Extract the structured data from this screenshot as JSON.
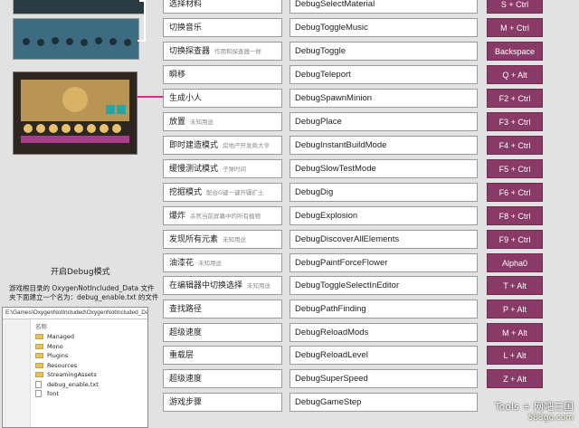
{
  "rows": [
    {
      "name": "选择材料",
      "note": "",
      "command": "DebugSelectMaterial",
      "key": "S + Ctrl"
    },
    {
      "name": "切换音乐",
      "note": "",
      "command": "DebugToggleMusic",
      "key": "M + Ctrl"
    },
    {
      "name": "切换探查器",
      "note": "作用和探查器一样",
      "command": "DebugToggle",
      "key": "Backspace"
    },
    {
      "name": "瞬移",
      "note": "",
      "command": "DebugTeleport",
      "key": "Q + Alt"
    },
    {
      "name": "生成小人",
      "note": "",
      "command": "DebugSpawnMinion",
      "key": "F2 + Ctrl"
    },
    {
      "name": "放置",
      "note": "未知用途",
      "command": "DebugPlace",
      "key": "F3 + Ctrl"
    },
    {
      "name": "即时建造模式",
      "note": "房地产开发商大亨",
      "command": "DebugInstantBuildMode",
      "key": "F4 + Ctrl"
    },
    {
      "name": "缓慢测试模式",
      "note": "子弹时间",
      "command": "DebugSlowTestMode",
      "key": "F5 + Ctrl"
    },
    {
      "name": "挖掘模式",
      "note": "配合G键一键开疆扩土",
      "command": "DebugDig",
      "key": "F6 + Ctrl"
    },
    {
      "name": "爆炸",
      "note": "杀死当前屏幕中的所有植物",
      "command": "DebugExplosion",
      "key": "F8 + Ctrl"
    },
    {
      "name": "发现所有元素",
      "note": "未知用途",
      "command": "DebugDiscoverAllElements",
      "key": "F9 + Ctrl"
    },
    {
      "name": "油漆花",
      "note": "未知用途",
      "command": "DebugPaintForceFlower",
      "key": "Alpha0"
    },
    {
      "name": "在编辑器中切换选择",
      "note": "未知用途",
      "command": "DebugToggleSelectInEditor",
      "key": "T + Alt"
    },
    {
      "name": "查找路径",
      "note": "",
      "command": "DebugPathFinding",
      "key": "P + Alt"
    },
    {
      "name": "超级速度",
      "note": "",
      "command": "DebugReloadMods",
      "key": "M + Alt"
    },
    {
      "name": "重载层",
      "note": "",
      "command": "DebugReloadLevel",
      "key": "L + Alt"
    },
    {
      "name": "超级速度",
      "note": "",
      "command": "DebugSuperSpeed",
      "key": "Z + Alt"
    },
    {
      "name": "游戏步骤",
      "note": "",
      "command": "DebugGameStep",
      "key": ""
    }
  ],
  "left": {
    "heading": "开启Debug模式",
    "desc_line1": "游戏根目录的 OxygenNotIncluded_Data 文件",
    "desc_line2": "夹下面建立一个名为：debug_enable.txt 的文件",
    "path": "E:\\Games\\OxygenNotIncluded\\OxygenNotIncluded_Data",
    "column_header": "名称",
    "files": [
      {
        "name": "Managed",
        "type": "folder"
      },
      {
        "name": "Mono",
        "type": "folder"
      },
      {
        "name": "Plugins",
        "type": "folder"
      },
      {
        "name": "Resources",
        "type": "folder"
      },
      {
        "name": "StreamingAssets",
        "type": "folder"
      },
      {
        "name": "debug_enable.txt",
        "type": "file"
      },
      {
        "name": "font",
        "type": "file"
      }
    ]
  },
  "watermark": {
    "line1": "Tools + 网吧三国",
    "line2": "583go.com"
  },
  "colors": {
    "key_bg": "#8a3a66",
    "accent_line": "#e2268e",
    "background": "#e2e2e2"
  }
}
